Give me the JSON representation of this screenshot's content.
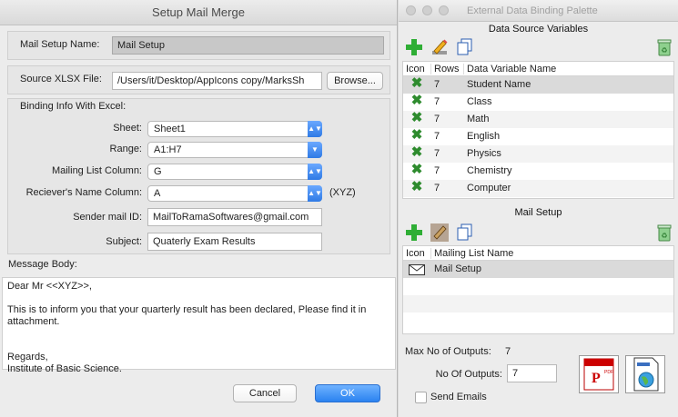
{
  "dialog": {
    "title": "Setup Mail Merge",
    "mail_setup_name_label": "Mail Setup Name:",
    "mail_setup_name_value": "Mail Setup",
    "source_label": "Source XLSX File:",
    "source_value": "/Users/it/Desktop/AppIcons copy/MarksSh",
    "browse_label": "Browse...",
    "binding_heading": "Binding Info With Excel:",
    "sheet_label": "Sheet:",
    "sheet_value": "Sheet1",
    "range_label": "Range:",
    "range_value": "A1:H7",
    "mailing_col_label": "Mailing List Column:",
    "mailing_col_value": "G",
    "receiver_col_label": "Reciever's Name Column:",
    "receiver_col_value": "A",
    "receiver_hint": "(XYZ)",
    "sender_label": "Sender mail ID:",
    "sender_value": "MailToRamaSoftwares@gmail.com",
    "subject_label": "Subject:",
    "subject_value": "Quaterly Exam Results",
    "message_label": "Message Body:",
    "message_value": "Dear Mr <<XYZ>>,\n\nThis is to inform you that your quarterly result has been declared, Please find it in attachment.\n\n\nRegards,\nInstitute of Basic Science.",
    "cancel_label": "Cancel",
    "ok_label": "OK",
    "accent": "#2a82f0"
  },
  "palette": {
    "title": "External Data Binding Palette",
    "data_source_heading": "Data Source Variables",
    "columns": {
      "icon": "Icon",
      "rows": "Rows",
      "name": "Data Variable Name"
    },
    "variables": [
      {
        "rows": "7",
        "name": "Student Name"
      },
      {
        "rows": "7",
        "name": "Class"
      },
      {
        "rows": "7",
        "name": "Math"
      },
      {
        "rows": "7",
        "name": "English"
      },
      {
        "rows": "7",
        "name": "Physics"
      },
      {
        "rows": "7",
        "name": "Chemistry"
      },
      {
        "rows": "7",
        "name": "Computer"
      }
    ],
    "mail_setup_heading": "Mail Setup",
    "mail_columns": {
      "icon": "Icon",
      "name": "Mailing List Name"
    },
    "mail_items": [
      {
        "name": "Mail Setup"
      }
    ],
    "max_outputs_label": "Max No of Outputs:",
    "max_outputs_value": "7",
    "no_outputs_label": "No Of Outputs:",
    "no_outputs_value": "7",
    "send_emails_label": "Send Emails",
    "icons": {
      "add": "plus-icon",
      "edit": "pencil-icon",
      "copy": "documents-icon",
      "trash": "trash-icon",
      "variable": "excel-x-icon",
      "mail": "envelope-icon",
      "pdf": "pdf-icon",
      "html": "html-globe-icon"
    }
  }
}
